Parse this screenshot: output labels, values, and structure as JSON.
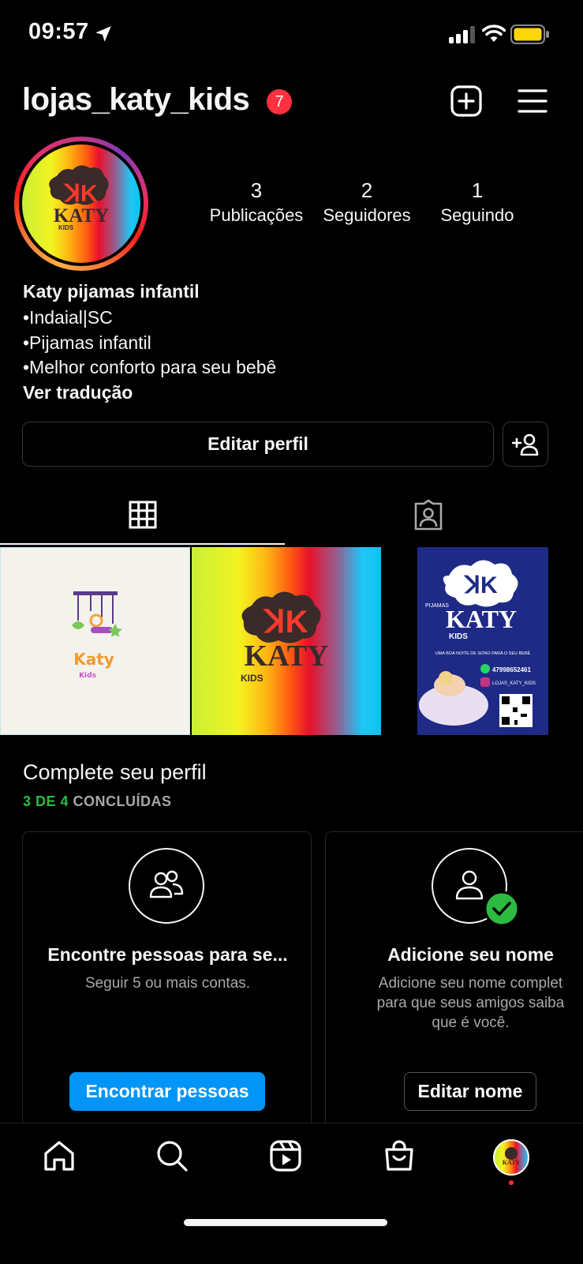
{
  "status_bar": {
    "time": "09:57"
  },
  "header": {
    "username": "lojas_katy_kids",
    "notification_count": "7"
  },
  "avatar": {
    "logo_text": "KATY",
    "logo_sub": "KIDS"
  },
  "stats": [
    {
      "value": "3",
      "label": "Publicações"
    },
    {
      "value": "2",
      "label": "Seguidores"
    },
    {
      "value": "1",
      "label": "Seguindo"
    }
  ],
  "bio": {
    "name": "Katy pijamas infantil",
    "lines": [
      "•Indaial|SC",
      "•Pijamas infantil",
      "•Melhor conforto para seu bebê"
    ],
    "translate": "Ver tradução"
  },
  "actions": {
    "edit_profile": "Editar perfil"
  },
  "posts": [
    {
      "title": "Katy",
      "sub": "Kids"
    },
    {
      "title": "KATY",
      "sub": "KIDS"
    },
    {
      "pre": "PIJAMAS",
      "title": "KATY",
      "sub": "KIDS",
      "slogan": "UMA BOA NOITE DE SONO PARA O SEU BEBÊ",
      "phone": "47998652461",
      "handle": "LOJAS_KATY_KIDS"
    }
  ],
  "complete_profile": {
    "title": "Complete seu perfil",
    "progress_done": "3 DE 4",
    "progress_label": " CONCLUÍDAS",
    "cards": [
      {
        "title": "Encontre pessoas para se...",
        "desc": "Seguir 5 ou mais contas.",
        "button": "Encontrar pessoas"
      },
      {
        "title": "Adicione seu nome",
        "desc_line1": "Adicione seu nome complet",
        "desc_line2": "para que seus amigos saiba",
        "desc_line3": "que é você.",
        "button": "Editar nome"
      }
    ]
  },
  "colors": {
    "accent": "#0095f6",
    "badge": "#ff3040",
    "success": "#2dba40",
    "background": "#000000"
  },
  "nav": [
    "home-icon",
    "search-icon",
    "reels-icon",
    "shop-icon",
    "profile-avatar"
  ]
}
